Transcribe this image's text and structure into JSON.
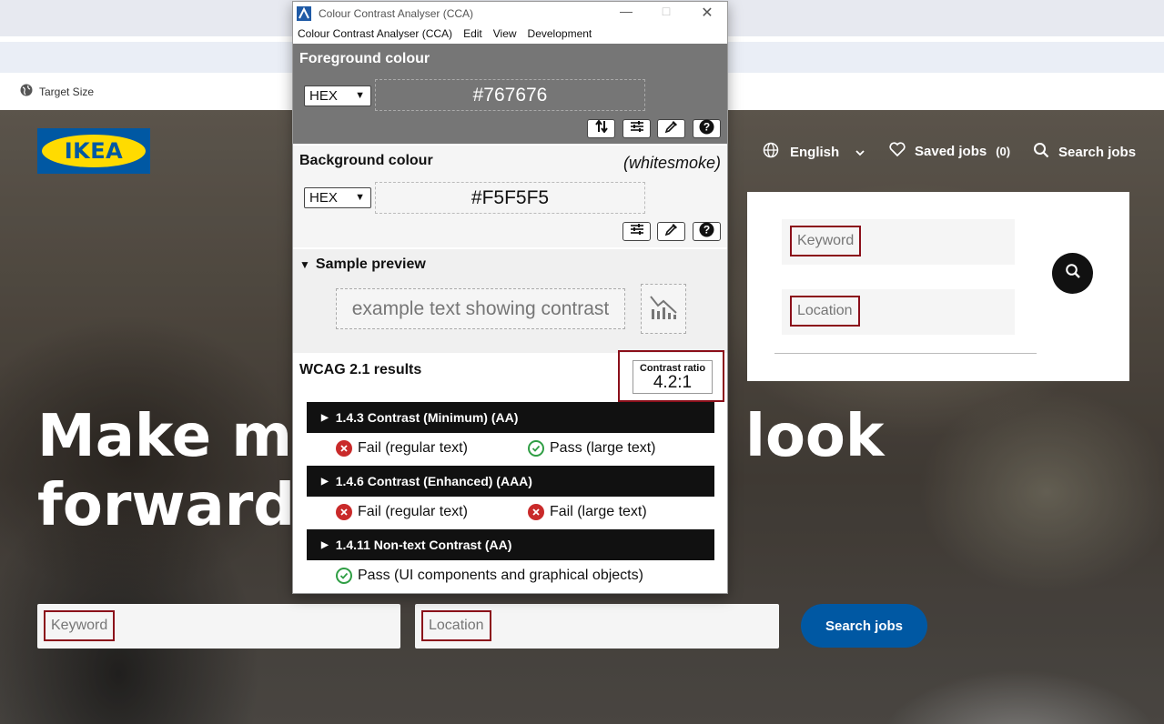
{
  "browser": {
    "extension_label": "Target Size"
  },
  "site": {
    "logo_text": "IKEA",
    "nav": {
      "language": "English",
      "saved_jobs": "Saved jobs",
      "saved_count": "(0)",
      "search_jobs": "Search jobs"
    },
    "hero_title_line1": "Make mi",
    "hero_title_line1_right": "look",
    "hero_title_line2": "forward t",
    "panel": {
      "keyword_placeholder": "Keyword",
      "location_placeholder": "Location"
    },
    "bottom": {
      "keyword_placeholder": "Keyword",
      "location_placeholder": "Location",
      "search_button": "Search jobs"
    },
    "colors": {
      "brand_blue": "#0058a3",
      "brand_yellow": "#ffdb00",
      "highlight_border": "#8b0f1a"
    }
  },
  "cca": {
    "window_title": "Colour Contrast Analyser (CCA)",
    "menu": [
      "Colour Contrast Analyser (CCA)",
      "Edit",
      "View",
      "Development"
    ],
    "foreground": {
      "heading": "Foreground colour",
      "format": "HEX",
      "value": "#767676"
    },
    "background": {
      "heading": "Background colour",
      "alias": "(whitesmoke)",
      "format": "HEX",
      "value": "#F5F5F5"
    },
    "preview": {
      "heading": "Sample preview",
      "sample_text": "example text showing contrast"
    },
    "results": {
      "heading": "WCAG 2.1 results",
      "ratio_label": "Contrast ratio",
      "ratio_value": "4.2:1",
      "criteria": [
        {
          "title": "1.4.3 Contrast (Minimum) (AA)",
          "results": [
            {
              "status": "fail",
              "text": "Fail (regular text)"
            },
            {
              "status": "pass",
              "text": "Pass (large text)"
            }
          ]
        },
        {
          "title": "1.4.6 Contrast (Enhanced) (AAA)",
          "results": [
            {
              "status": "fail",
              "text": "Fail (regular text)"
            },
            {
              "status": "fail",
              "text": "Fail (large text)"
            }
          ]
        },
        {
          "title": "1.4.11 Non-text Contrast (AA)",
          "results": [
            {
              "status": "pass",
              "text": "Pass (UI components and graphical objects)"
            }
          ]
        }
      ]
    }
  }
}
